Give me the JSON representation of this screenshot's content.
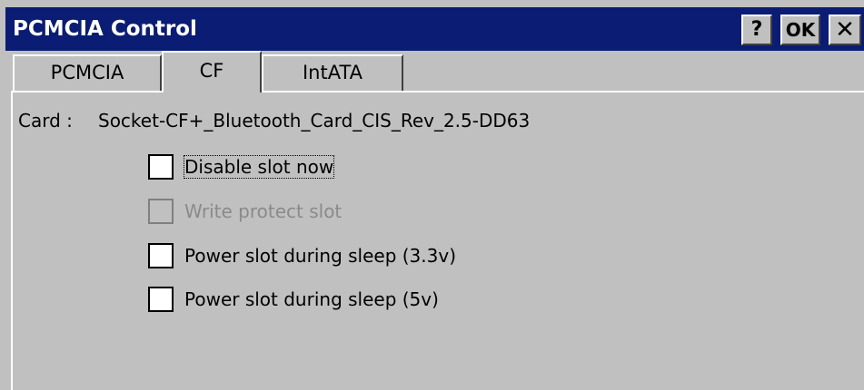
{
  "window": {
    "title": "PCMCIA Control",
    "help_label": "?",
    "ok_label": "OK",
    "close_label": "✕"
  },
  "tabs": [
    {
      "label": "PCMCIA",
      "active": false
    },
    {
      "label": "CF",
      "active": true
    },
    {
      "label": "IntATA",
      "active": false
    }
  ],
  "card": {
    "label": "Card :",
    "value": "Socket-CF+_Bluetooth_Card_CIS_Rev_2.5-DD63"
  },
  "options": [
    {
      "label": "Disable slot now",
      "checked": false,
      "enabled": true
    },
    {
      "label": "Write protect slot",
      "checked": false,
      "enabled": false
    },
    {
      "label": "Power slot during sleep (3.3v)",
      "checked": false,
      "enabled": true
    },
    {
      "label": "Power slot during sleep (5v)",
      "checked": false,
      "enabled": true
    }
  ],
  "colors": {
    "titlebar": "#0a1c73",
    "background": "#c0c0c0",
    "disabled_text": "#8a8a8a"
  }
}
